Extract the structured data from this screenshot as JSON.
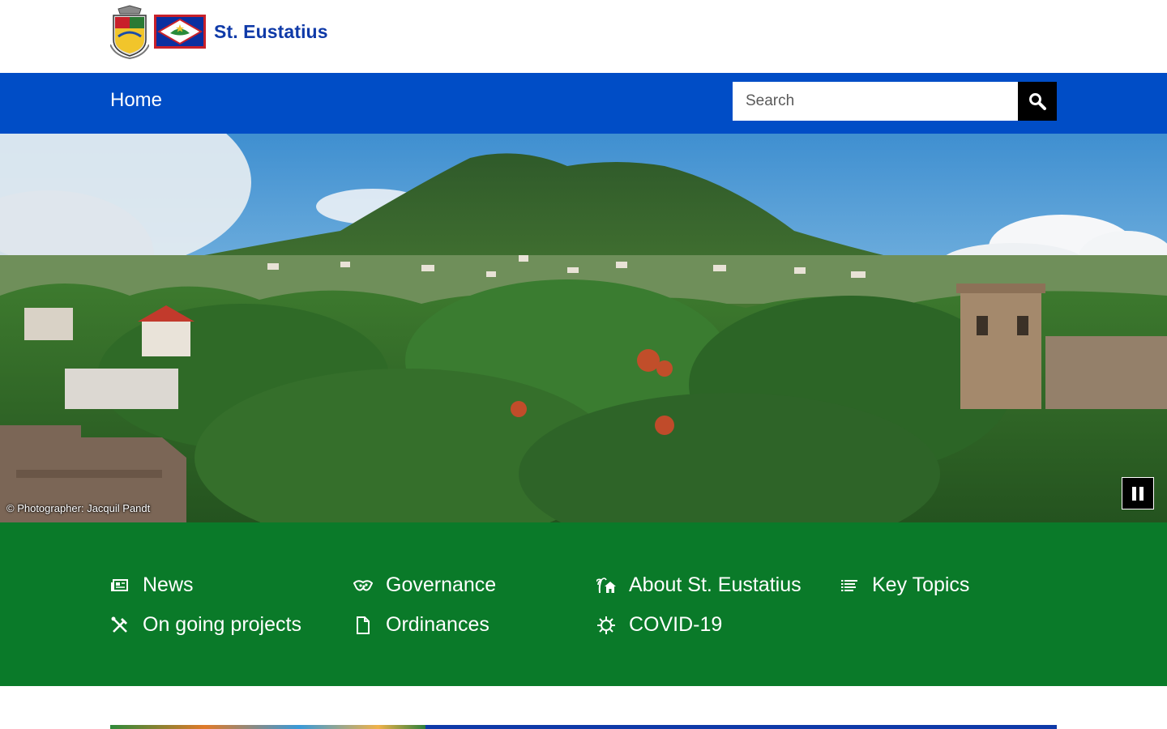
{
  "site": {
    "name": "St. Eustatius",
    "colors": {
      "brand_blue": "#004dc6",
      "title_blue": "#0f3aa8",
      "menu_green": "#0a7a29"
    }
  },
  "nav": {
    "home_label": "Home",
    "search": {
      "placeholder": "Search",
      "value": "",
      "button_icon": "search-icon"
    }
  },
  "hero": {
    "credit": "© Photographer: Jacquil Pandt",
    "control_icon": "pause-icon"
  },
  "menu": {
    "items": [
      {
        "label": "News",
        "icon": "newspaper-icon"
      },
      {
        "label": "Governance",
        "icon": "handshake-icon"
      },
      {
        "label": "About St. Eustatius",
        "icon": "island-house-icon"
      },
      {
        "label": "Key Topics",
        "icon": "list-icon"
      },
      {
        "label": "On going projects",
        "icon": "tools-icon"
      },
      {
        "label": "Ordinances",
        "icon": "document-icon"
      },
      {
        "label": "COVID-19",
        "icon": "virus-icon"
      }
    ]
  }
}
